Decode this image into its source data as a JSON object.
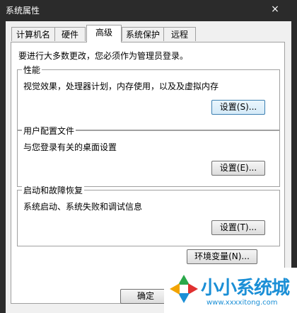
{
  "window": {
    "title": "系统属性",
    "close_glyph": "×"
  },
  "tabs": [
    {
      "label": "计算机名",
      "active": false
    },
    {
      "label": "硬件",
      "active": false
    },
    {
      "label": "高级",
      "active": true
    },
    {
      "label": "系统保护",
      "active": false
    },
    {
      "label": "远程",
      "active": false
    }
  ],
  "notice": "要进行大多数更改，您必须作为管理员登录。",
  "groups": {
    "performance": {
      "legend": "性能",
      "description": "视觉效果，处理器计划，内存使用，以及及虚拟内存",
      "button": "设置(S)..."
    },
    "profile": {
      "legend": "用户配置文件",
      "description": "与您登录有关的桌面设置",
      "button": "设置(E)..."
    },
    "startup": {
      "legend": "启动和故障恢复",
      "description": "系统启动、系统失败和调试信息",
      "button": "设置(T)..."
    }
  },
  "env_button": "环境变量(N)...",
  "footer": {
    "ok": "确定"
  },
  "watermark": {
    "text": "小小系统城",
    "url": "www.xxxxitong.com",
    "color": "#1b8fd6"
  }
}
